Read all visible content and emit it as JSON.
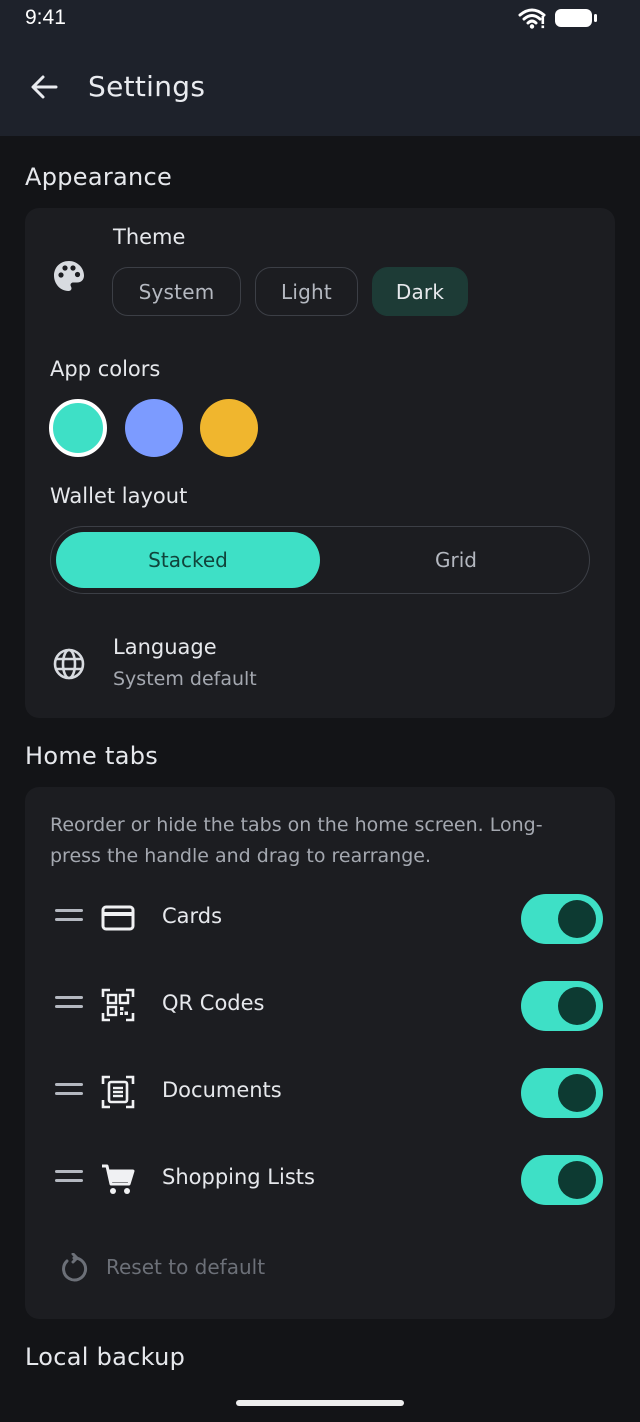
{
  "status_bar": {
    "time": "9:41"
  },
  "header": {
    "title": "Settings"
  },
  "appearance": {
    "section_title": "Appearance",
    "theme": {
      "label": "Theme",
      "options": [
        "System",
        "Light",
        "Dark"
      ],
      "selected": "Dark"
    },
    "app_colors": {
      "label": "App colors",
      "swatches": [
        "#3ee0c6",
        "#7c9bff",
        "#f0b62e"
      ],
      "selected": "#3ee0c6"
    },
    "wallet_layout": {
      "label": "Wallet layout",
      "options": [
        "Stacked",
        "Grid"
      ],
      "selected": "Stacked"
    },
    "language": {
      "label": "Language",
      "value": "System default"
    }
  },
  "home_tabs": {
    "section_title": "Home tabs",
    "description": "Reorder or hide the tabs on the home screen. Long-press the handle and drag to rearrange.",
    "tabs": [
      {
        "label": "Cards",
        "icon": "card-icon",
        "enabled": true
      },
      {
        "label": "QR Codes",
        "icon": "qr-code-icon",
        "enabled": true
      },
      {
        "label": "Documents",
        "icon": "document-icon",
        "enabled": true
      },
      {
        "label": "Shopping Lists",
        "icon": "cart-icon",
        "enabled": true
      }
    ],
    "reset_label": "Reset to default"
  },
  "local_backup": {
    "section_title": "Local backup"
  },
  "colors": {
    "accent": "#3ee0c6",
    "background": "#131417",
    "card": "#1c1d21",
    "header": "#1e222b"
  }
}
